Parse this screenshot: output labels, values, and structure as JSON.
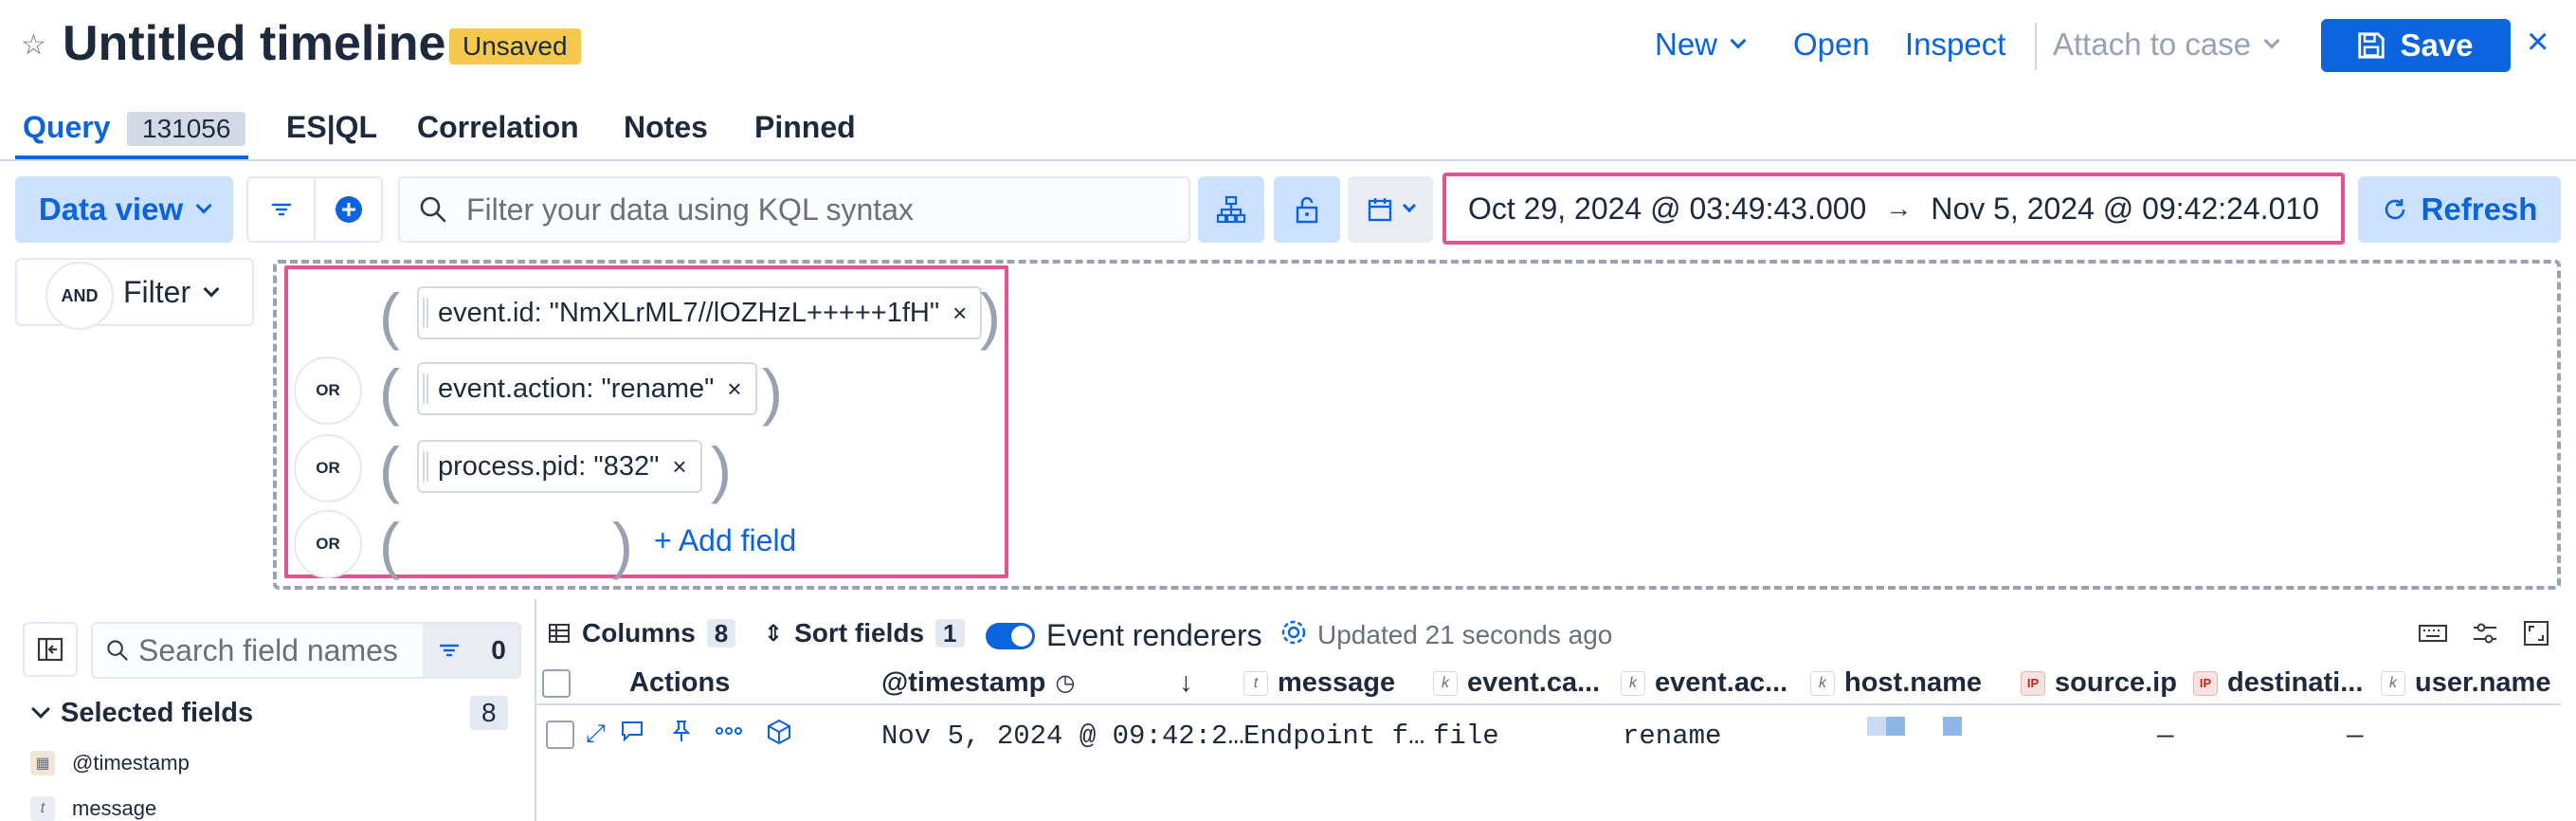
{
  "header": {
    "title": "Untitled timeline",
    "badge": "Unsaved",
    "new_label": "New",
    "open_label": "Open",
    "inspect_label": "Inspect",
    "attach_label": "Attach to case",
    "save_label": "Save"
  },
  "tabs": [
    {
      "label": "Query",
      "count": "131056"
    },
    {
      "label": "ES|QL"
    },
    {
      "label": "Correlation"
    },
    {
      "label": "Notes"
    },
    {
      "label": "Pinned"
    }
  ],
  "query_bar": {
    "data_view_label": "Data view",
    "kql_placeholder": "Filter your data using KQL syntax",
    "date_start": "Oct 29, 2024 @ 03:49:43.000",
    "date_end": "Nov 5, 2024 @ 09:42:24.010",
    "refresh_label": "Refresh"
  },
  "builder": {
    "and_label": "AND",
    "filter_label": "Filter",
    "or_label": "OR",
    "groups": [
      {
        "pill": "event.id: \"NmXLrML7//lOZHzL+++++1fH\""
      },
      {
        "pill": "event.action: \"rename\""
      },
      {
        "pill": "process.pid: \"832\""
      }
    ],
    "add_field_label": "+ Add field"
  },
  "fields_panel": {
    "search_placeholder": "Search field names",
    "filter_count": "0",
    "selected_label": "Selected fields",
    "selected_count": "8",
    "items": [
      {
        "type": "date",
        "name": "@timestamp"
      },
      {
        "type": "t",
        "name": "message"
      }
    ]
  },
  "toolbar": {
    "columns_label": "Columns",
    "columns_count": "8",
    "sort_label": "Sort fields",
    "sort_count": "1",
    "renderers_label": "Event renderers",
    "updated_text": "Updated 21 seconds ago"
  },
  "table": {
    "actions_label": "Actions",
    "columns": [
      {
        "name": "@timestamp",
        "type": "clock"
      },
      {
        "name": "message",
        "type": "t"
      },
      {
        "name": "event.ca...",
        "type": "k"
      },
      {
        "name": "event.ac...",
        "type": "k"
      },
      {
        "name": "host.name",
        "type": "k"
      },
      {
        "name": "source.ip",
        "type": "IP"
      },
      {
        "name": "destinati...",
        "type": "IP"
      },
      {
        "name": "user.name",
        "type": "k"
      }
    ],
    "row": {
      "timestamp": "Nov 5, 2024 @ 09:42:2…",
      "message": "Endpoint f…",
      "category": "file",
      "action": "rename",
      "source_ip": "—",
      "destination": "—"
    }
  },
  "colors": {
    "primary": "#0b64dd",
    "highlight": "#e0558f",
    "badge": "#f6c84e"
  }
}
